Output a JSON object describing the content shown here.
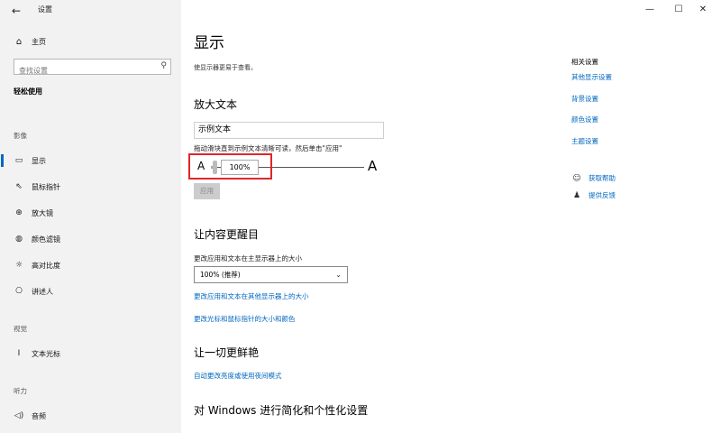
{
  "window": {
    "title": "设置",
    "back_icon": "←",
    "min_icon": "—",
    "max_icon": "☐",
    "close_icon": "✕"
  },
  "sidebar": {
    "home_label": "主页",
    "search_placeholder": "查找设置",
    "section_title": "轻松使用",
    "groups": {
      "vision": "影像",
      "hearing": "视觉",
      "audio": "听力"
    },
    "items": [
      {
        "label": "显示",
        "icon": "display-icon"
      },
      {
        "label": "鼠标指针",
        "icon": "mouse-pointer-icon"
      },
      {
        "label": "放大镜",
        "icon": "magnifier-icon"
      },
      {
        "label": "颜色滤镜",
        "icon": "color-filter-icon"
      },
      {
        "label": "高对比度",
        "icon": "high-contrast-icon"
      },
      {
        "label": "讲述人",
        "icon": "narrator-icon"
      },
      {
        "label": "文本光标",
        "icon": "text-cursor-icon"
      },
      {
        "label": "音频",
        "icon": "audio-icon"
      }
    ]
  },
  "main": {
    "title": "显示",
    "description": "使显示器更易于查看。",
    "enlarge_text": {
      "title": "放大文本",
      "sample_text": "示例文本",
      "hint": "拖动滑块直到示例文本清晰可读，然后单击\"应用\"",
      "small_a": "A",
      "big_a": "A",
      "slider_value": "100%",
      "slider_fraction": 0.0,
      "apply_label": "应用"
    },
    "stand_out": {
      "title": "让内容更醒目",
      "label": "更改应用和文本在主显示器上的大小",
      "dropdown_value": "100% (推荐)",
      "link1": "更改应用和文本在其他显示器上的大小",
      "link2": "更改光标和鼠标指针的大小和颜色"
    },
    "vivid": {
      "title": "让一切更鲜艳",
      "link": "自动更改亮度或使用夜间模式"
    },
    "personalize": {
      "title": "对 Windows 进行简化和个性化设置"
    }
  },
  "right": {
    "related_title": "相关设置",
    "links": [
      "其他显示设置",
      "背景设置",
      "颜色设置",
      "主题设置"
    ],
    "help": "获取帮助",
    "feedback": "提供反馈"
  },
  "colors": {
    "accent": "#0067c0",
    "highlight": "#e0262c",
    "sidebar_bg": "#f2f2f2"
  }
}
